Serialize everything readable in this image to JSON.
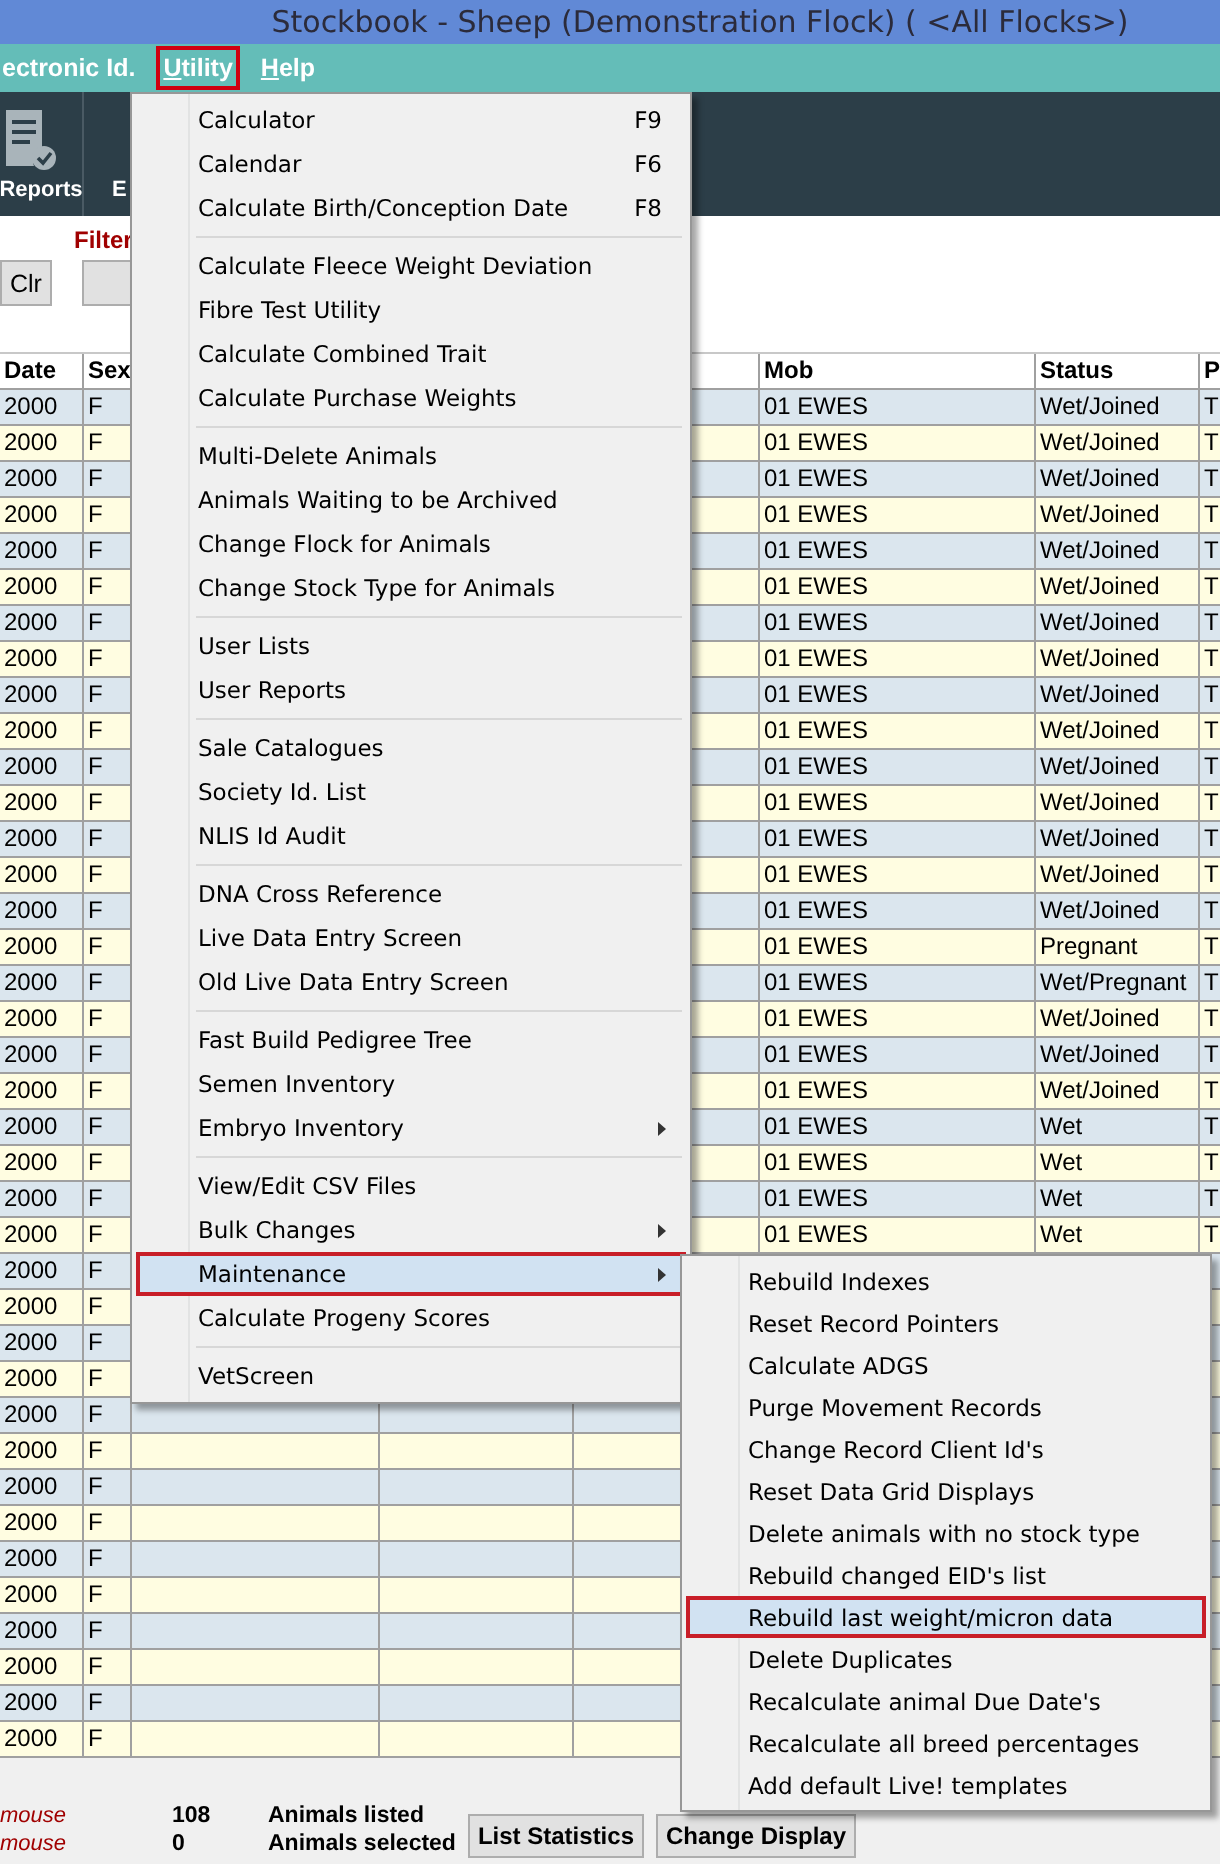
{
  "window": {
    "title": "Stockbook - Sheep (Demonstration Flock) ( <All Flocks>)"
  },
  "menu_bar": [
    {
      "label": "ectronic Id.",
      "accelerator": false,
      "selected": false
    },
    {
      "label": "Utility",
      "accelerator": true,
      "selected": true
    },
    {
      "label": "Help",
      "accelerator": true,
      "selected": false
    }
  ],
  "toolbar": [
    {
      "label": "Reports",
      "kind": "icon-button"
    },
    {
      "label": "E",
      "kind": "text-button"
    }
  ],
  "filter": {
    "label": "Filter",
    "clear_button": "Clr"
  },
  "grid": {
    "columns": [
      "Date",
      "Sex",
      null,
      null,
      null,
      "Mob",
      "Status",
      "P"
    ],
    "rows": [
      [
        "2000",
        "F",
        null,
        null,
        null,
        "01 EWES",
        "Wet/Joined",
        "T"
      ],
      [
        "2000",
        "F",
        null,
        null,
        null,
        "01 EWES",
        "Wet/Joined",
        "T"
      ],
      [
        "2000",
        "F",
        null,
        null,
        null,
        "01 EWES",
        "Wet/Joined",
        "T"
      ],
      [
        "2000",
        "F",
        null,
        null,
        null,
        "01 EWES",
        "Wet/Joined",
        "T"
      ],
      [
        "2000",
        "F",
        null,
        null,
        null,
        "01 EWES",
        "Wet/Joined",
        "T"
      ],
      [
        "2000",
        "F",
        null,
        null,
        null,
        "01 EWES",
        "Wet/Joined",
        "T"
      ],
      [
        "2000",
        "F",
        null,
        null,
        null,
        "01 EWES",
        "Wet/Joined",
        "T"
      ],
      [
        "2000",
        "F",
        null,
        null,
        null,
        "01 EWES",
        "Wet/Joined",
        "T"
      ],
      [
        "2000",
        "F",
        null,
        null,
        null,
        "01 EWES",
        "Wet/Joined",
        "T"
      ],
      [
        "2000",
        "F",
        null,
        null,
        null,
        "01 EWES",
        "Wet/Joined",
        "T"
      ],
      [
        "2000",
        "F",
        null,
        null,
        null,
        "01 EWES",
        "Wet/Joined",
        "T"
      ],
      [
        "2000",
        "F",
        null,
        null,
        null,
        "01 EWES",
        "Wet/Joined",
        "T"
      ],
      [
        "2000",
        "F",
        null,
        null,
        null,
        "01 EWES",
        "Wet/Joined",
        "T"
      ],
      [
        "2000",
        "F",
        null,
        null,
        null,
        "01 EWES",
        "Wet/Joined",
        "T"
      ],
      [
        "2000",
        "F",
        null,
        null,
        null,
        "01 EWES",
        "Wet/Joined",
        "T"
      ],
      [
        "2000",
        "F",
        null,
        null,
        null,
        "01 EWES",
        "Pregnant",
        "T"
      ],
      [
        "2000",
        "F",
        null,
        null,
        null,
        "01 EWES",
        "Wet/Pregnant",
        "T"
      ],
      [
        "2000",
        "F",
        null,
        null,
        null,
        "01 EWES",
        "Wet/Joined",
        "T"
      ],
      [
        "2000",
        "F",
        null,
        null,
        null,
        "01 EWES",
        "Wet/Joined",
        "T"
      ],
      [
        "2000",
        "F",
        null,
        null,
        null,
        "01 EWES",
        "Wet/Joined",
        "T"
      ],
      [
        "2000",
        "F",
        null,
        null,
        null,
        "01 EWES",
        "Wet",
        "T"
      ],
      [
        "2000",
        "F",
        null,
        null,
        null,
        "01 EWES",
        "Wet",
        "T"
      ],
      [
        "2000",
        "F",
        null,
        null,
        null,
        "01 EWES",
        "Wet",
        "T"
      ],
      [
        "2000",
        "F",
        null,
        null,
        null,
        "01 EWES",
        "Wet",
        "T"
      ],
      [
        "2000",
        "F",
        null,
        null,
        null,
        null,
        null,
        null
      ],
      [
        "2000",
        "F",
        null,
        null,
        null,
        null,
        null,
        null
      ],
      [
        "2000",
        "F",
        null,
        null,
        null,
        null,
        null,
        null
      ],
      [
        "2000",
        "F",
        null,
        null,
        null,
        null,
        null,
        null
      ],
      [
        "2000",
        "F",
        null,
        null,
        null,
        null,
        null,
        null
      ],
      [
        "2000",
        "F",
        null,
        null,
        null,
        null,
        null,
        null
      ],
      [
        "2000",
        "F",
        null,
        null,
        null,
        null,
        null,
        null
      ],
      [
        "2000",
        "F",
        null,
        null,
        null,
        null,
        null,
        null
      ],
      [
        "2000",
        "F",
        null,
        null,
        null,
        null,
        null,
        null
      ],
      [
        "2000",
        "F",
        null,
        null,
        null,
        null,
        null,
        null
      ],
      [
        "2000",
        "F",
        null,
        null,
        null,
        null,
        null,
        null
      ],
      [
        "2000",
        "F",
        null,
        null,
        null,
        null,
        null,
        null
      ],
      [
        "2000",
        "F",
        null,
        null,
        null,
        null,
        null,
        null
      ],
      [
        "2000",
        "F",
        null,
        null,
        null,
        null,
        null,
        null
      ]
    ]
  },
  "status_bar": {
    "counts": [
      {
        "note": "mouse",
        "count": "108",
        "label": "Animals listed"
      },
      {
        "note": "mouse",
        "count": "0",
        "label": "Animals selected"
      }
    ],
    "buttons": [
      "List Statistics",
      "Change Display"
    ]
  },
  "utility_menu": {
    "groups": [
      [
        {
          "label": "Calculator",
          "shortcut": "F9",
          "submenu": false,
          "selected": false
        },
        {
          "label": "Calendar",
          "shortcut": "F6",
          "submenu": false,
          "selected": false
        },
        {
          "label": "Calculate Birth/Conception Date",
          "shortcut": "F8",
          "submenu": false,
          "selected": false
        }
      ],
      [
        {
          "label": "Calculate Fleece Weight Deviation",
          "submenu": false,
          "selected": false
        },
        {
          "label": "Fibre Test Utility",
          "submenu": false,
          "selected": false
        },
        {
          "label": "Calculate Combined Trait",
          "submenu": false,
          "selected": false
        },
        {
          "label": "Calculate Purchase Weights",
          "submenu": false,
          "selected": false
        }
      ],
      [
        {
          "label": "Multi-Delete Animals",
          "submenu": false,
          "selected": false
        },
        {
          "label": "Animals Waiting to be Archived",
          "submenu": false,
          "selected": false
        },
        {
          "label": "Change Flock for Animals",
          "submenu": false,
          "selected": false
        },
        {
          "label": "Change Stock Type for Animals",
          "submenu": false,
          "selected": false
        }
      ],
      [
        {
          "label": "User Lists",
          "submenu": false,
          "selected": false
        },
        {
          "label": "User Reports",
          "submenu": false,
          "selected": false
        }
      ],
      [
        {
          "label": "Sale Catalogues",
          "submenu": false,
          "selected": false
        },
        {
          "label": "Society Id. List",
          "submenu": false,
          "selected": false
        },
        {
          "label": "NLIS Id Audit",
          "submenu": false,
          "selected": false
        }
      ],
      [
        {
          "label": "DNA Cross Reference",
          "submenu": false,
          "selected": false
        },
        {
          "label": "Live Data Entry Screen",
          "submenu": false,
          "selected": false
        },
        {
          "label": "Old Live Data Entry Screen",
          "submenu": false,
          "selected": false
        }
      ],
      [
        {
          "label": "Fast Build Pedigree Tree",
          "submenu": false,
          "selected": false
        },
        {
          "label": "Semen Inventory",
          "submenu": false,
          "selected": false
        },
        {
          "label": "Embryo Inventory",
          "submenu": true,
          "selected": false
        }
      ],
      [
        {
          "label": "View/Edit CSV Files",
          "submenu": false,
          "selected": false
        },
        {
          "label": "Bulk Changes",
          "submenu": true,
          "selected": false
        },
        {
          "label": "Maintenance",
          "submenu": true,
          "selected": true
        },
        {
          "label": "Calculate Progeny Scores",
          "submenu": false,
          "selected": false
        }
      ],
      [
        {
          "label": "VetScreen",
          "submenu": false,
          "selected": false
        }
      ]
    ]
  },
  "maintenance_menu": {
    "items": [
      {
        "label": "Rebuild Indexes",
        "selected": false
      },
      {
        "label": "Reset Record Pointers",
        "selected": false
      },
      {
        "label": "Calculate ADGS",
        "selected": false
      },
      {
        "label": "Purge Movement Records",
        "selected": false
      },
      {
        "label": "Change Record Client Id's",
        "selected": false
      },
      {
        "label": "Reset Data Grid Displays",
        "selected": false
      },
      {
        "label": "Delete animals with no stock type",
        "selected": false
      },
      {
        "label": "Rebuild changed EID's list",
        "selected": false
      },
      {
        "label": "Rebuild last weight/micron data",
        "selected": true
      },
      {
        "label": "Delete Duplicates",
        "selected": false
      },
      {
        "label": "Recalculate animal Due Date's",
        "selected": false
      },
      {
        "label": "Recalculate all breed percentages",
        "selected": false
      },
      {
        "label": "Add default Live! templates",
        "selected": false
      }
    ]
  }
}
